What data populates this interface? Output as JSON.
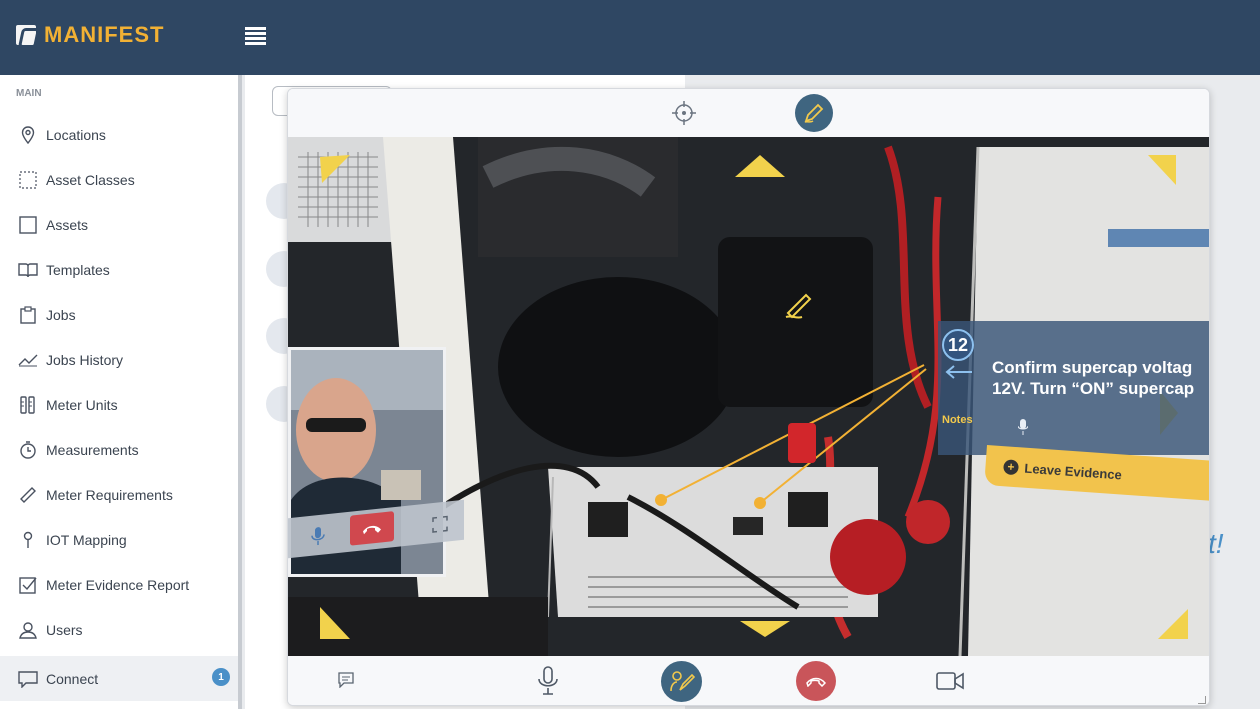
{
  "app": {
    "brand": "MANIFEST",
    "accent_color": "#f2b134",
    "header_color": "#2f4763"
  },
  "sidebar": {
    "section_label": "MAIN",
    "items": [
      {
        "label": "Locations",
        "icon": "map-pin-icon"
      },
      {
        "label": "Asset Classes",
        "icon": "dotted-square-icon"
      },
      {
        "label": "Assets",
        "icon": "square-icon"
      },
      {
        "label": "Templates",
        "icon": "book-icon"
      },
      {
        "label": "Jobs",
        "icon": "clipboard-icon"
      },
      {
        "label": "Jobs History",
        "icon": "trend-line-icon"
      },
      {
        "label": "Meter Units",
        "icon": "meter-icon"
      },
      {
        "label": "Measurements",
        "icon": "stopwatch-icon"
      },
      {
        "label": "Meter Requirements",
        "icon": "ruler-icon"
      },
      {
        "label": "IOT Mapping",
        "icon": "pin-icon"
      },
      {
        "label": "Meter Evidence Report",
        "icon": "checkbox-icon"
      },
      {
        "label": "Users",
        "icon": "user-icon"
      },
      {
        "label": "Connect",
        "icon": "chat-icon",
        "badge": "1",
        "active": true
      }
    ]
  },
  "main": {
    "tail_text": "t!"
  },
  "call": {
    "ar": {
      "step": "12",
      "instruction_line1": "Confirm supercap voltag",
      "instruction_line2": "12V. Turn “ON” supercap",
      "notes_label": "Notes",
      "evidence_label": "Leave Evidence"
    },
    "controls": {
      "top": [
        "crosshair-icon",
        "annotate-pen-icon"
      ],
      "bottom": [
        "chat-icon",
        "microphone-icon",
        "annotate-pen-icon",
        "hangup-icon",
        "video-camera-icon"
      ]
    }
  }
}
